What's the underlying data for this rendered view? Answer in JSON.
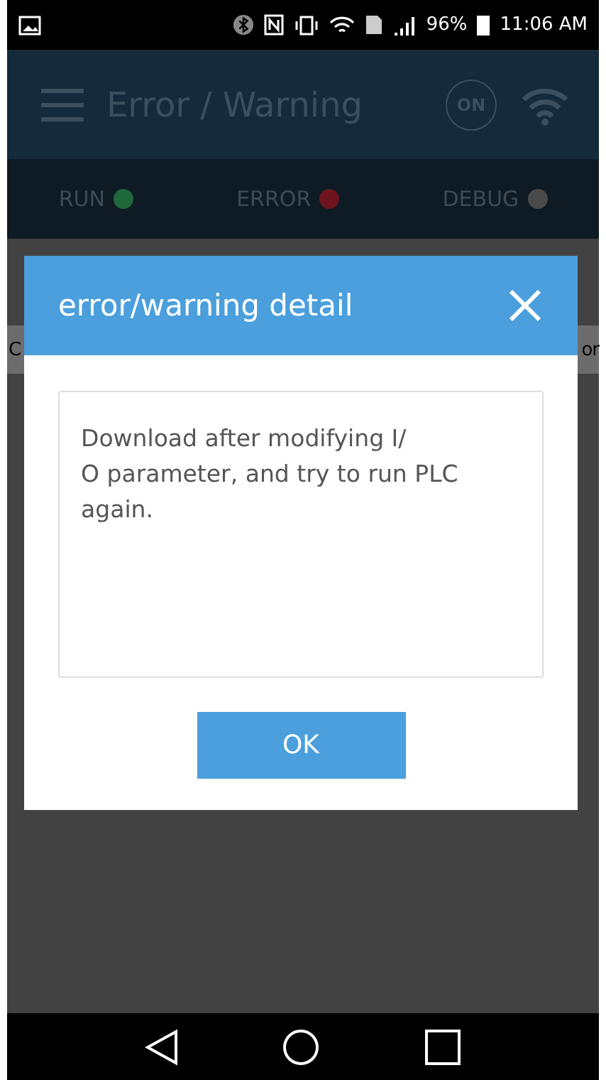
{
  "status_bar": {
    "battery": "96%",
    "time": "11:06 AM"
  },
  "app_bar": {
    "title": "Error / Warning",
    "badge": "ON"
  },
  "indicators": [
    {
      "label": "RUN",
      "color": "#1f6a3a"
    },
    {
      "label": "ERROR",
      "color": "#6e1420"
    },
    {
      "label": "DEBUG",
      "color": "#4a4a4a"
    }
  ],
  "background_row": {
    "left": "C",
    "right": "or"
  },
  "dialog": {
    "title": "error/warning detail",
    "message": "Download after modifying I/\nO parameter, and try to run PLC again.",
    "button": "OK"
  }
}
